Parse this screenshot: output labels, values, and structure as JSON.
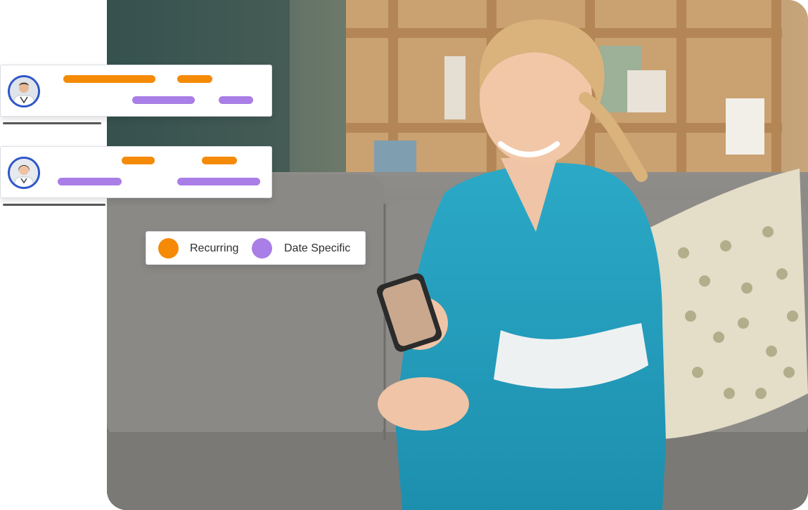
{
  "legend": {
    "recurring_label": "Recurring",
    "date_specific_label": "Date Specific",
    "recurring_color": "#f58a07",
    "date_specific_color": "#a97ee6"
  },
  "cards": [
    {
      "avatar_icon": "male-doctor-avatar-icon",
      "bars": [
        "recurring",
        "recurring",
        "date-specific",
        "date-specific"
      ]
    },
    {
      "avatar_icon": "female-doctor-avatar-icon",
      "bars": [
        "recurring",
        "recurring",
        "date-specific",
        "date-specific"
      ]
    }
  ],
  "photo": {
    "subject": "nurse-in-scrubs-on-sofa-with-phone"
  }
}
